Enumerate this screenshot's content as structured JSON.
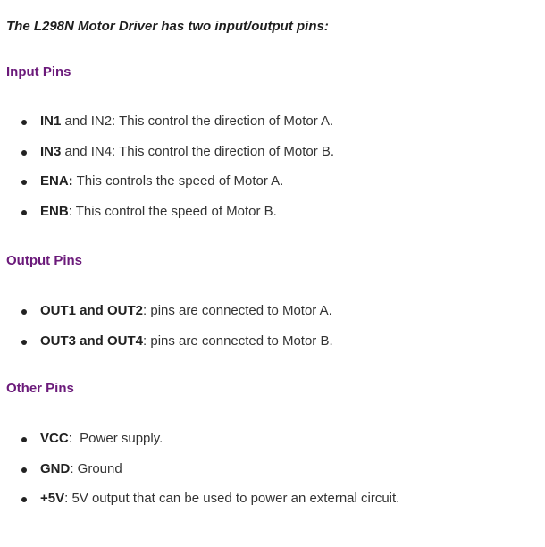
{
  "intro": "The L298N Motor Driver has two input/output pins:",
  "sections": [
    {
      "heading": "Input Pins",
      "items": [
        {
          "term": "IN1",
          "rest": " and IN2: This control the direction of Motor A."
        },
        {
          "term": "IN3",
          "rest": " and IN4: This control the direction of Motor B."
        },
        {
          "term": "ENA:",
          "rest": " This controls the speed of Motor A."
        },
        {
          "term": "ENB",
          "rest": ": This control the speed of Motor B."
        }
      ]
    },
    {
      "heading": "Output Pins",
      "items": [
        {
          "term": "OUT1 and OUT2",
          "rest": ": pins are connected to Motor A."
        },
        {
          "term": "OUT3 and OUT4",
          "rest": ": pins are connected to Motor B."
        }
      ]
    },
    {
      "heading": "Other Pins",
      "items": [
        {
          "term": "VCC",
          "rest": ":  Power supply."
        },
        {
          "term": "GND",
          "rest": ": Ground"
        },
        {
          "term": "+5V",
          "rest": ": 5V output that can be used to power an external circuit."
        }
      ]
    }
  ]
}
